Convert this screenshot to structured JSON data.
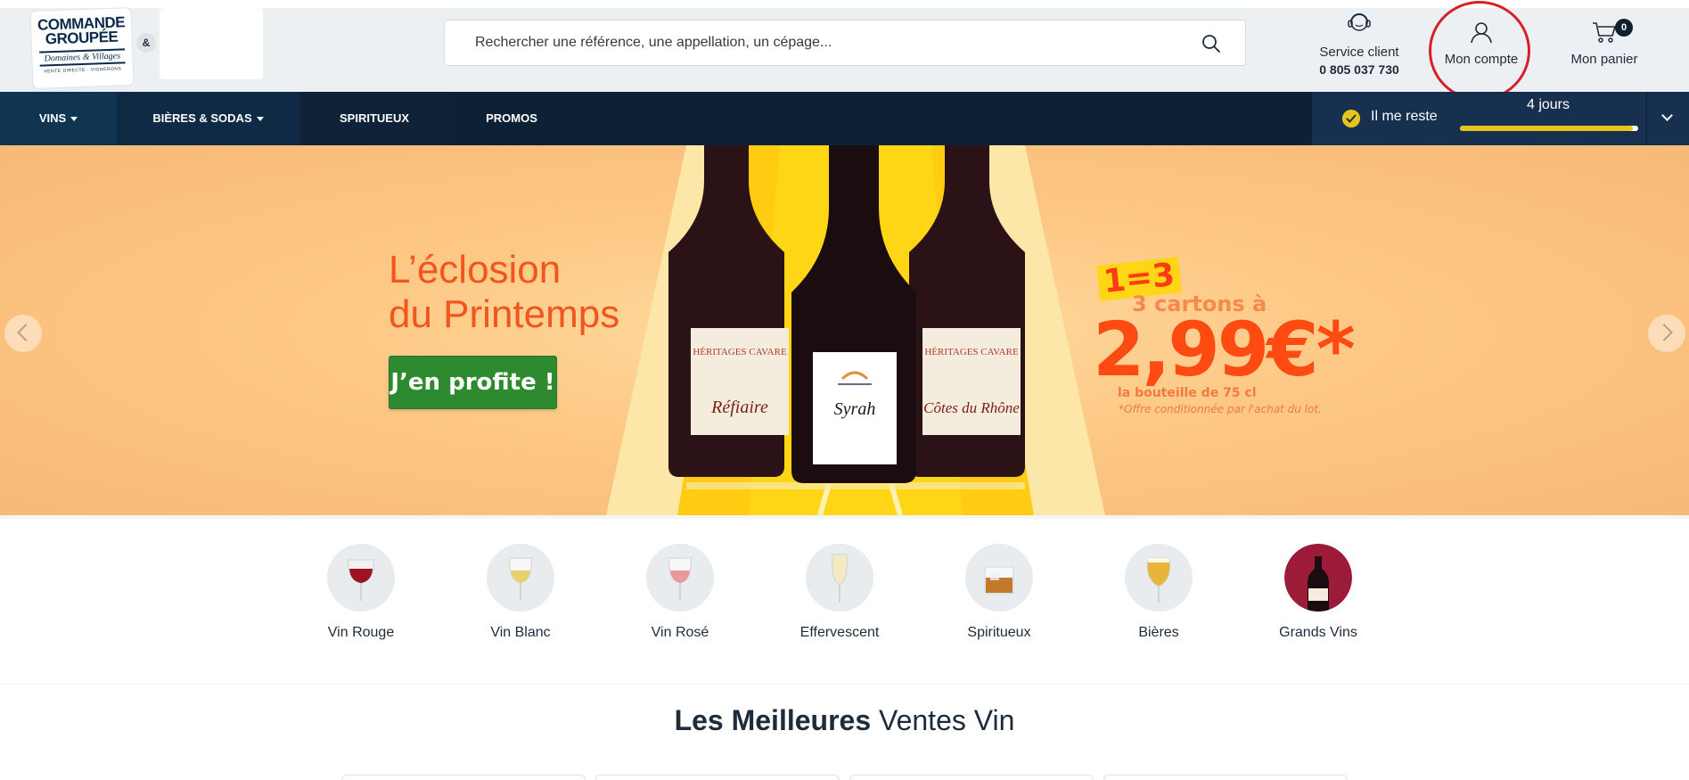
{
  "header": {
    "logo": {
      "line1": "COMMANDE",
      "line2": "GROUPÉE",
      "line3": "Domaines & Villages",
      "line4": "VENTE DIRECTE · VIGNERONS",
      "amp": "&"
    },
    "search": {
      "placeholder": "Rechercher une référence, une appellation, un cépage..."
    },
    "service": {
      "label": "Service client",
      "phone": "0 805 037 730"
    },
    "account": {
      "label": "Mon compte"
    },
    "cart": {
      "label": "Mon panier",
      "count": "0"
    }
  },
  "nav": {
    "tabs": [
      {
        "label": "VINS",
        "dropdown": true
      },
      {
        "label": "BIÈRES & SODAS",
        "dropdown": true
      },
      {
        "label": "SPIRITUEUX",
        "dropdown": false
      },
      {
        "label": "PROMOS",
        "dropdown": false
      }
    ],
    "countdown": {
      "label": "Il me reste",
      "days": "4 jours",
      "progress": 0.97
    }
  },
  "banner": {
    "title_line1": "L’éclosion",
    "title_line2": "du Printemps",
    "cta": "J’en profite !",
    "promo_tag": "1=3",
    "promo_line": "3 cartons à",
    "promo_price": "2,99€*",
    "promo_sub": "la bouteille de 75 cl",
    "promo_note": "*Offre conditionnée par l'achat du lot.",
    "bottle_labels": [
      "HÉRITAGES CAVARE",
      "Syrah",
      "HÉRITAGES CAVARE"
    ],
    "colors": {
      "accent": "#f1561d",
      "cta": "#2d8a2e",
      "tag": "#ffd615"
    }
  },
  "categories": [
    {
      "label": "Vin Rouge",
      "icon": "red-wine-glass-icon"
    },
    {
      "label": "Vin Blanc",
      "icon": "white-wine-glass-icon"
    },
    {
      "label": "Vin Rosé",
      "icon": "rose-wine-glass-icon"
    },
    {
      "label": "Effervescent",
      "icon": "champagne-flute-icon"
    },
    {
      "label": "Spiritueux",
      "icon": "whisky-glass-icon"
    },
    {
      "label": "Bières",
      "icon": "beer-glass-icon"
    },
    {
      "label": "Grands Vins",
      "icon": "wine-bottle-icon"
    }
  ],
  "best_sellers": {
    "bold": "Les Meilleures",
    "rest": "Ventes Vin"
  },
  "colors": {
    "nav_bg": "#0d2136",
    "highlight_circle": "#d81f26",
    "text": "#1d2b3a"
  }
}
